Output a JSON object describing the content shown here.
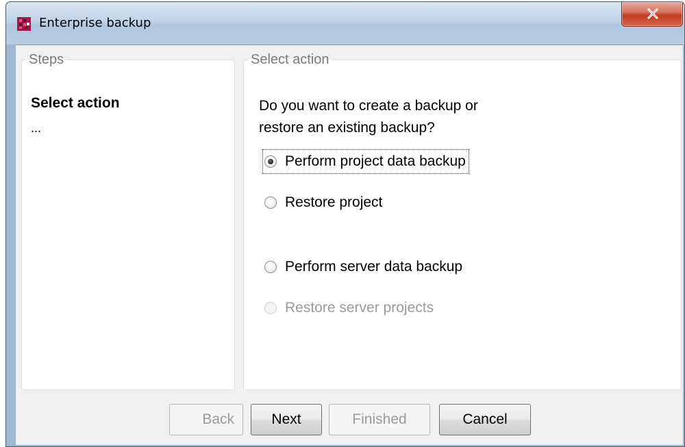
{
  "window": {
    "title": "Enterprise backup",
    "close_label": "Close"
  },
  "steps_panel": {
    "legend": "Steps",
    "active_step": "Select action",
    "more": "..."
  },
  "action_panel": {
    "legend": "Select action",
    "question_line1": "Do you want to create a backup or",
    "question_line2": "restore an existing backup?",
    "options": [
      {
        "label": "Perform project data backup",
        "checked": true,
        "enabled": true
      },
      {
        "label": "Restore project",
        "checked": false,
        "enabled": true
      },
      {
        "label": "Perform server data backup",
        "checked": false,
        "enabled": true
      },
      {
        "label": "Restore server projects",
        "checked": false,
        "enabled": false
      }
    ]
  },
  "buttons": {
    "back": "Back",
    "next": "Next",
    "finished": "Finished",
    "cancel": "Cancel"
  },
  "colors": {
    "app_icon": "#a3174a",
    "close_button": "#c94a30",
    "disabled_text": "#9a9a9a"
  }
}
